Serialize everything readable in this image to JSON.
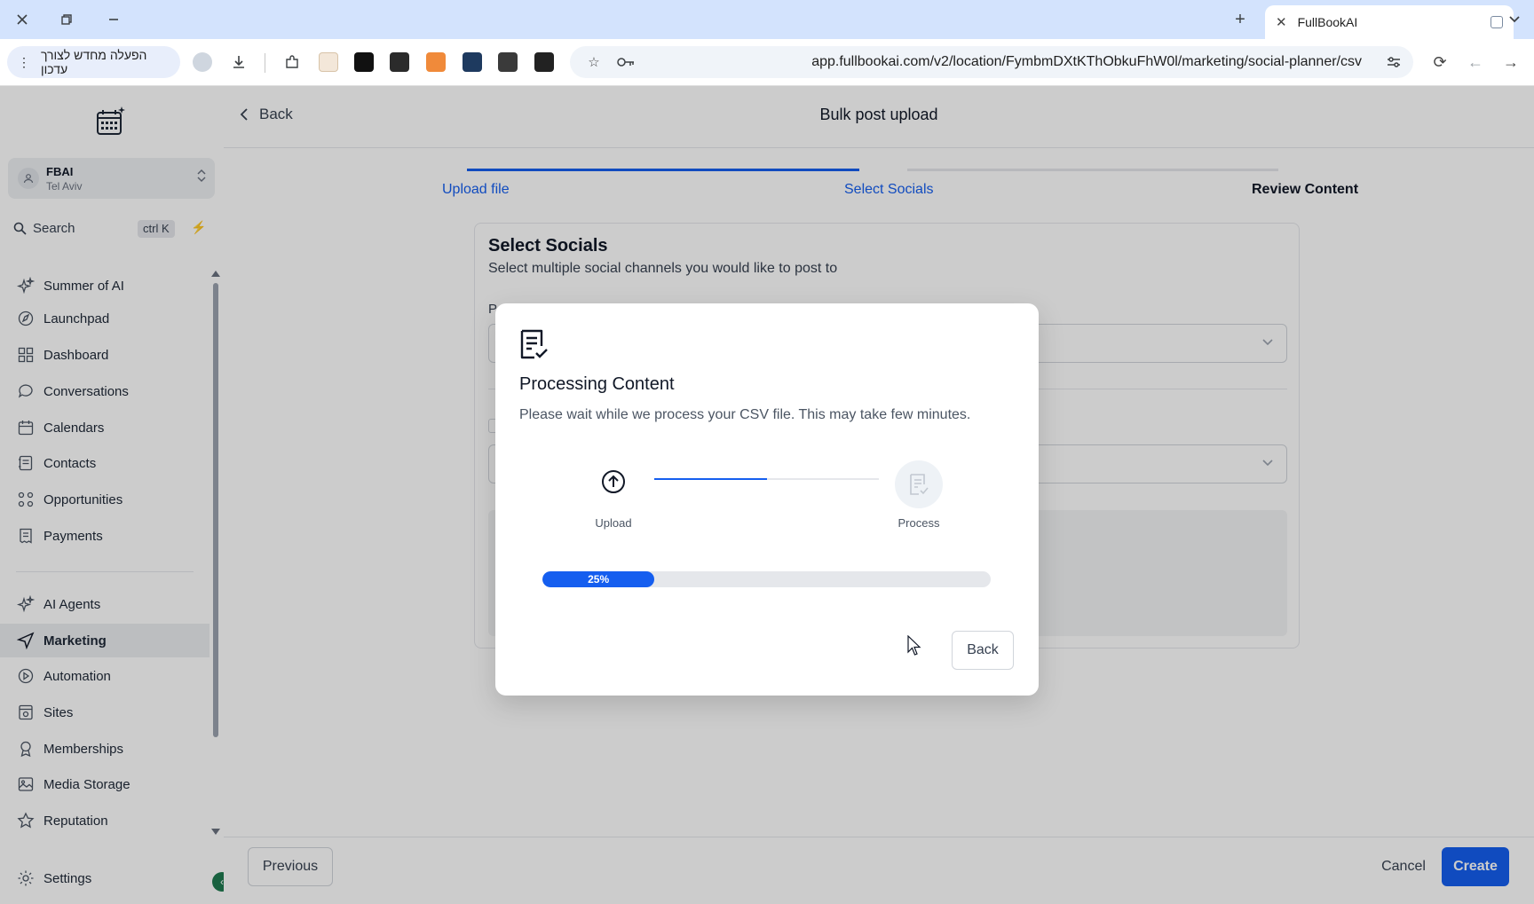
{
  "browser": {
    "tab_title": "FullBookAI",
    "update_label": "הפעלה מחדש לצורך עדכון",
    "url": "app.fullbookai.com/v2/location/FymbmDXtKThObkuFhW0l/marketing/social-planner/csv"
  },
  "location": {
    "name": "FBAI",
    "city": "Tel Aviv"
  },
  "search": {
    "label": "Search",
    "shortcut": "ctrl K"
  },
  "sidebar": {
    "items": [
      {
        "label": "Summer of AI",
        "icon": "sparkle-icon"
      },
      {
        "label": "Launchpad",
        "icon": "rocket-icon"
      },
      {
        "label": "Dashboard",
        "icon": "grid-icon"
      },
      {
        "label": "Conversations",
        "icon": "chat-icon"
      },
      {
        "label": "Calendars",
        "icon": "calendar-icon"
      },
      {
        "label": "Contacts",
        "icon": "contacts-icon"
      },
      {
        "label": "Opportunities",
        "icon": "opportunities-icon"
      },
      {
        "label": "Payments",
        "icon": "receipt-icon"
      },
      {
        "label": "AI Agents",
        "icon": "sparkle-icon"
      },
      {
        "label": "Marketing",
        "icon": "send-icon",
        "active": true
      },
      {
        "label": "Automation",
        "icon": "automation-icon"
      },
      {
        "label": "Sites",
        "icon": "sites-icon"
      },
      {
        "label": "Memberships",
        "icon": "award-icon"
      },
      {
        "label": "Media Storage",
        "icon": "image-icon"
      },
      {
        "label": "Reputation",
        "icon": "star-icon"
      }
    ],
    "settings": "Settings"
  },
  "header": {
    "back": "Back",
    "title": "Bulk post upload"
  },
  "stepper": {
    "steps": [
      {
        "label": "Upload file",
        "state": "done"
      },
      {
        "label": "Select Socials",
        "state": "active"
      },
      {
        "label": "Review Content",
        "state": "upcoming"
      }
    ]
  },
  "card": {
    "title": "Select Socials",
    "subtitle": "Select multiple social channels you would like to post to",
    "field_label_partial": "P"
  },
  "footer": {
    "previous": "Previous",
    "cancel": "Cancel",
    "create": "Create"
  },
  "modal": {
    "title": "Processing Content",
    "description": "Please wait while we process your CSV file. This may take few minutes.",
    "step_upload": "Upload",
    "step_process": "Process",
    "progress_percent": 25,
    "progress_label": "25%",
    "back": "Back"
  },
  "colors": {
    "accent": "#155eef",
    "browser_frame": "#d3e3fd"
  }
}
